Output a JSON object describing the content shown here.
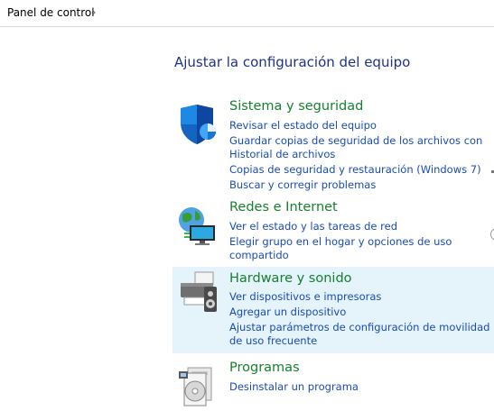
{
  "breadcrumb": {
    "root_label": "Panel de control",
    "chevron": "›"
  },
  "page": {
    "title": "Ajustar la configuración del equipo"
  },
  "categories": [
    {
      "title": "Sistema y seguridad",
      "icon": "shield-icon",
      "links": [
        "Revisar el estado del equipo",
        "Guardar copias de seguridad de los archivos con Historial de archivos",
        "Copias de seguridad y restauración (Windows 7)",
        "Buscar y corregir problemas"
      ]
    },
    {
      "title": "Redes e Internet",
      "icon": "network-globe-icon",
      "links": [
        "Ver el estado y las tareas de red",
        "Elegir grupo en el hogar y opciones de uso compartido"
      ]
    },
    {
      "title": "Hardware y sonido",
      "icon": "printer-speaker-icon",
      "hover": true,
      "links": [
        "Ver dispositivos e impresoras",
        "Agregar un dispositivo",
        "Ajustar parámetros de configuración de movilidad de uso frecuente"
      ]
    },
    {
      "title": "Programas",
      "icon": "programs-disc-icon",
      "links": [
        "Desinstalar un programa"
      ]
    }
  ],
  "colors": {
    "title": "#1e3287",
    "category_title": "#16802f",
    "link": "#1a4bb8",
    "hover_bg": "#e5f3fb"
  }
}
